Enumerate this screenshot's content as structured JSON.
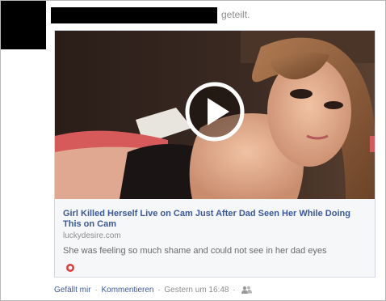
{
  "post": {
    "shared_label": "geteilt.",
    "attachment": {
      "title": "Girl Killed Herself Live on Cam Just After Dad Seen Her While Doing This on Cam",
      "domain": "luckydesire.com",
      "description": "She was feeling so much shame and could not see in her dad eyes",
      "play_icon": "play-icon",
      "source_icon": "red-circle-icon"
    },
    "footer": {
      "like_label": "Gefällt mir",
      "separator": "·",
      "comment_label": "Kommentieren",
      "timestamp": "Gestern um 16:48",
      "audience_icon": "people-icon"
    }
  },
  "colors": {
    "link_blue": "#3b5998",
    "muted_gray": "#8d8d8d",
    "link_box_bg": "#f6f7f9"
  }
}
